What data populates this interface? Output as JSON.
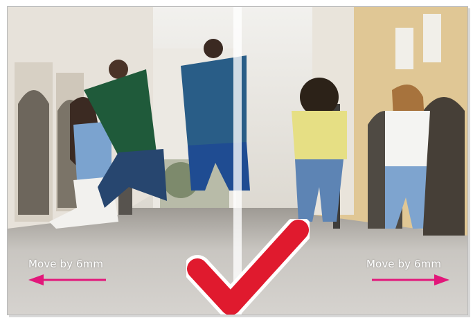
{
  "image": {
    "description_text": "",
    "overlay": {
      "left_label": "Move by 6mm",
      "right_label": "Move by 6mm",
      "arrow_color": "#e2177a",
      "check_color": "#e01a2e",
      "check_outline": "#ffffff"
    },
    "icons": {
      "left_arrow": "arrow-left-icon",
      "right_arrow": "arrow-right-icon",
      "check": "checkmark-icon"
    }
  }
}
